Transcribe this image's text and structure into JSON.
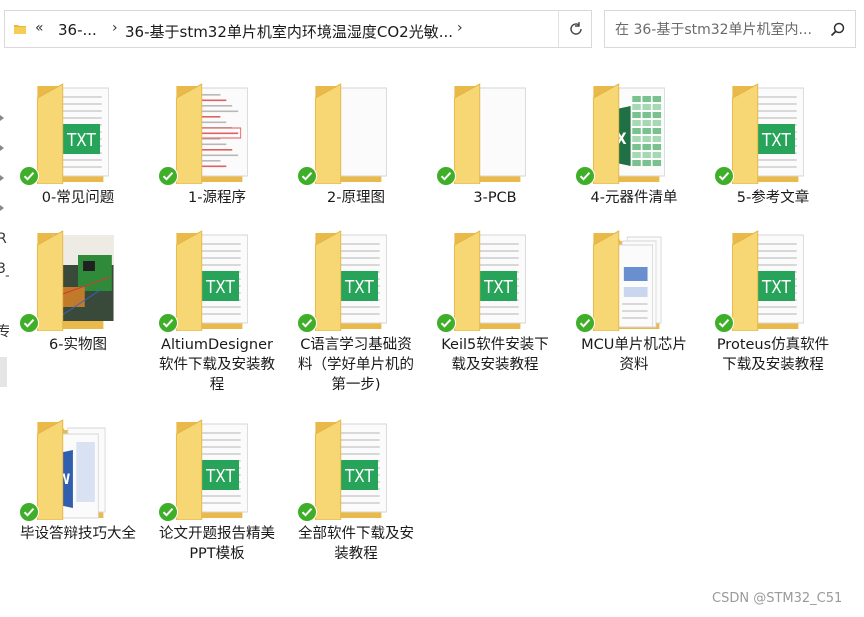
{
  "address_bar": {
    "chevron_more": "«",
    "crumb1": "36-...",
    "crumb2": "36-基于stm32单片机室内环境温湿度CO2光敏..."
  },
  "search": {
    "placeholder": "在 36-基于stm32单片机室内..."
  },
  "files": [
    {
      "label": "0-常见问题",
      "thumb": "folder-txt"
    },
    {
      "label": "1-源程序",
      "thumb": "folder-code"
    },
    {
      "label": "2-原理图",
      "thumb": "folder-blank"
    },
    {
      "label": "3-PCB",
      "thumb": "folder-blank"
    },
    {
      "label": "4-元器件清单",
      "thumb": "folder-excel"
    },
    {
      "label": "5-参考文章",
      "thumb": "folder-txt"
    },
    {
      "label": "6-实物图",
      "thumb": "folder-photo"
    },
    {
      "label": "AltiumDesigner软件下载及安装教程",
      "thumb": "folder-txt"
    },
    {
      "label": "C语言学习基础资料（学好单片机的第一步)",
      "thumb": "folder-txt"
    },
    {
      "label": "Keil5软件安装下载及安装教程",
      "thumb": "folder-txt"
    },
    {
      "label": "MCU单片机芯片资料",
      "thumb": "folder-docs"
    },
    {
      "label": "Proteus仿真软件下载及安装教程",
      "thumb": "folder-txt"
    },
    {
      "label": "毕设答辩技巧大全",
      "thumb": "folder-word"
    },
    {
      "label": "论文开题报告精美PPT模板",
      "thumb": "folder-txt"
    },
    {
      "label": "全部软件下载及安装教程",
      "thumb": "folder-txt"
    }
  ],
  "sync_status": "synced-check-icon",
  "watermark": "CSDN @STM32_C51",
  "nav_fragments": [
    "R",
    "3_",
    "专"
  ],
  "colors": {
    "folder": "#f7d774",
    "txt_badge": "#27a35a",
    "excel": "#1f7145",
    "check": "#3fae29"
  }
}
